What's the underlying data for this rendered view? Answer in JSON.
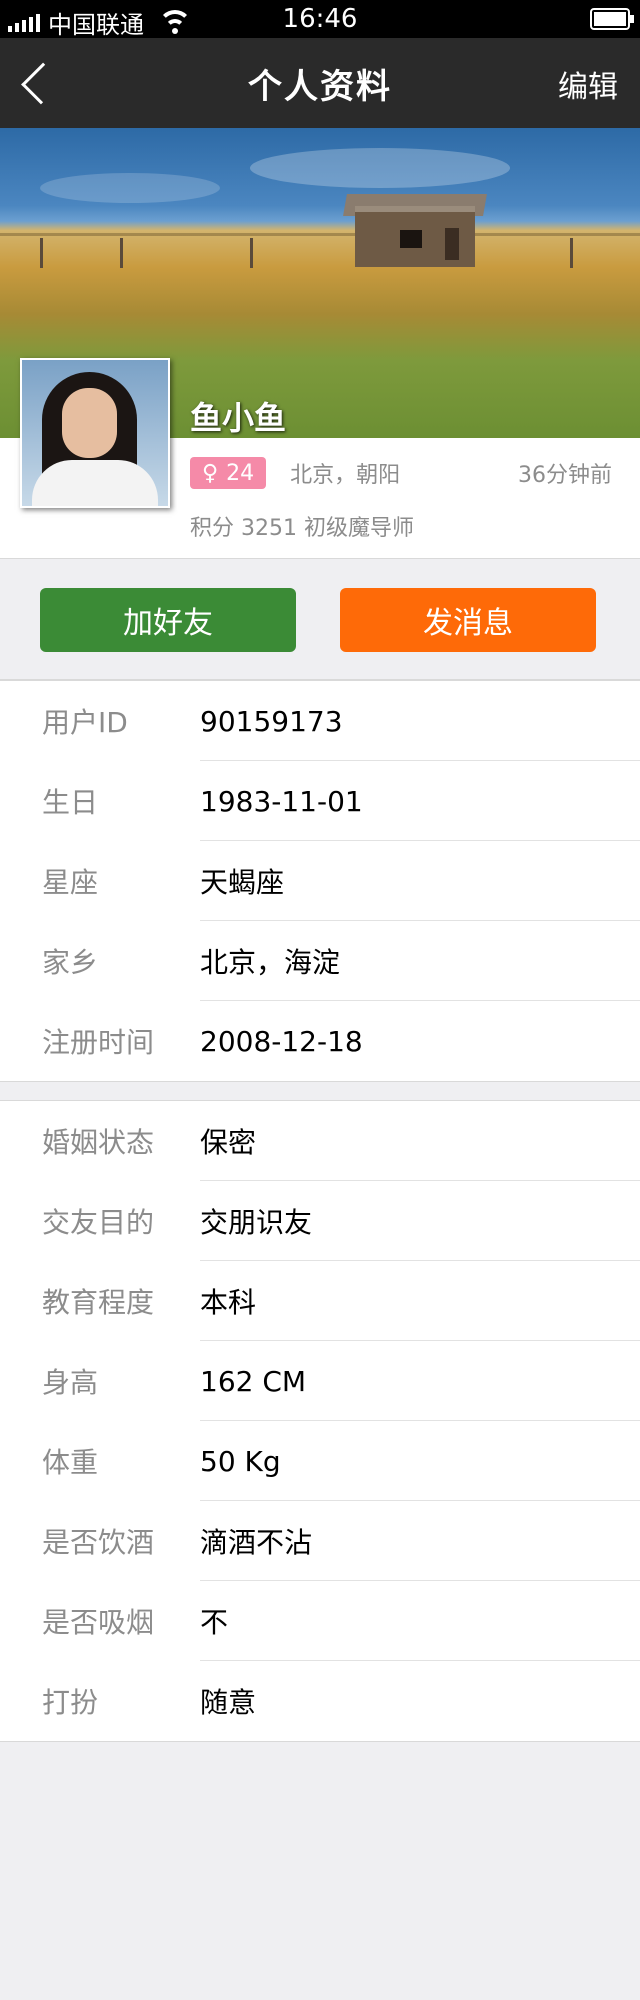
{
  "status_bar": {
    "carrier": "中国联通",
    "time": "16:46"
  },
  "nav": {
    "title": "个人资料",
    "edit_label": "编辑",
    "back_icon": "chevron-left-icon"
  },
  "profile": {
    "nickname": "鱼小鱼",
    "gender_symbol": "♀",
    "age": "24",
    "location": "北京，朝阳",
    "last_active": "36分钟前",
    "score_line": "积分 3251 初级魔导师"
  },
  "actions": {
    "add_friend": "加好友",
    "send_message": "发消息"
  },
  "basic_info": [
    {
      "label": "用户ID",
      "value": "90159173"
    },
    {
      "label": "生日",
      "value": "1983-11-01"
    },
    {
      "label": "星座",
      "value": "天蝎座"
    },
    {
      "label": "家乡",
      "value": "北京，海淀"
    },
    {
      "label": "注册时间",
      "value": "2008-12-18"
    }
  ],
  "details": [
    {
      "label": "婚姻状态",
      "value": "保密"
    },
    {
      "label": "交友目的",
      "value": "交朋识友"
    },
    {
      "label": "教育程度",
      "value": "本科"
    },
    {
      "label": "身高",
      "value": "162 CM"
    },
    {
      "label": "体重",
      "value": "50 Kg"
    },
    {
      "label": "是否饮酒",
      "value": "滴酒不沾"
    },
    {
      "label": "是否吸烟",
      "value": "不"
    },
    {
      "label": "打扮",
      "value": "随意"
    }
  ],
  "colors": {
    "add_button": "#3b8b36",
    "message_button": "#fe6a08",
    "gender_badge": "#f58aa8",
    "nav_bg": "#2a2a2a"
  }
}
